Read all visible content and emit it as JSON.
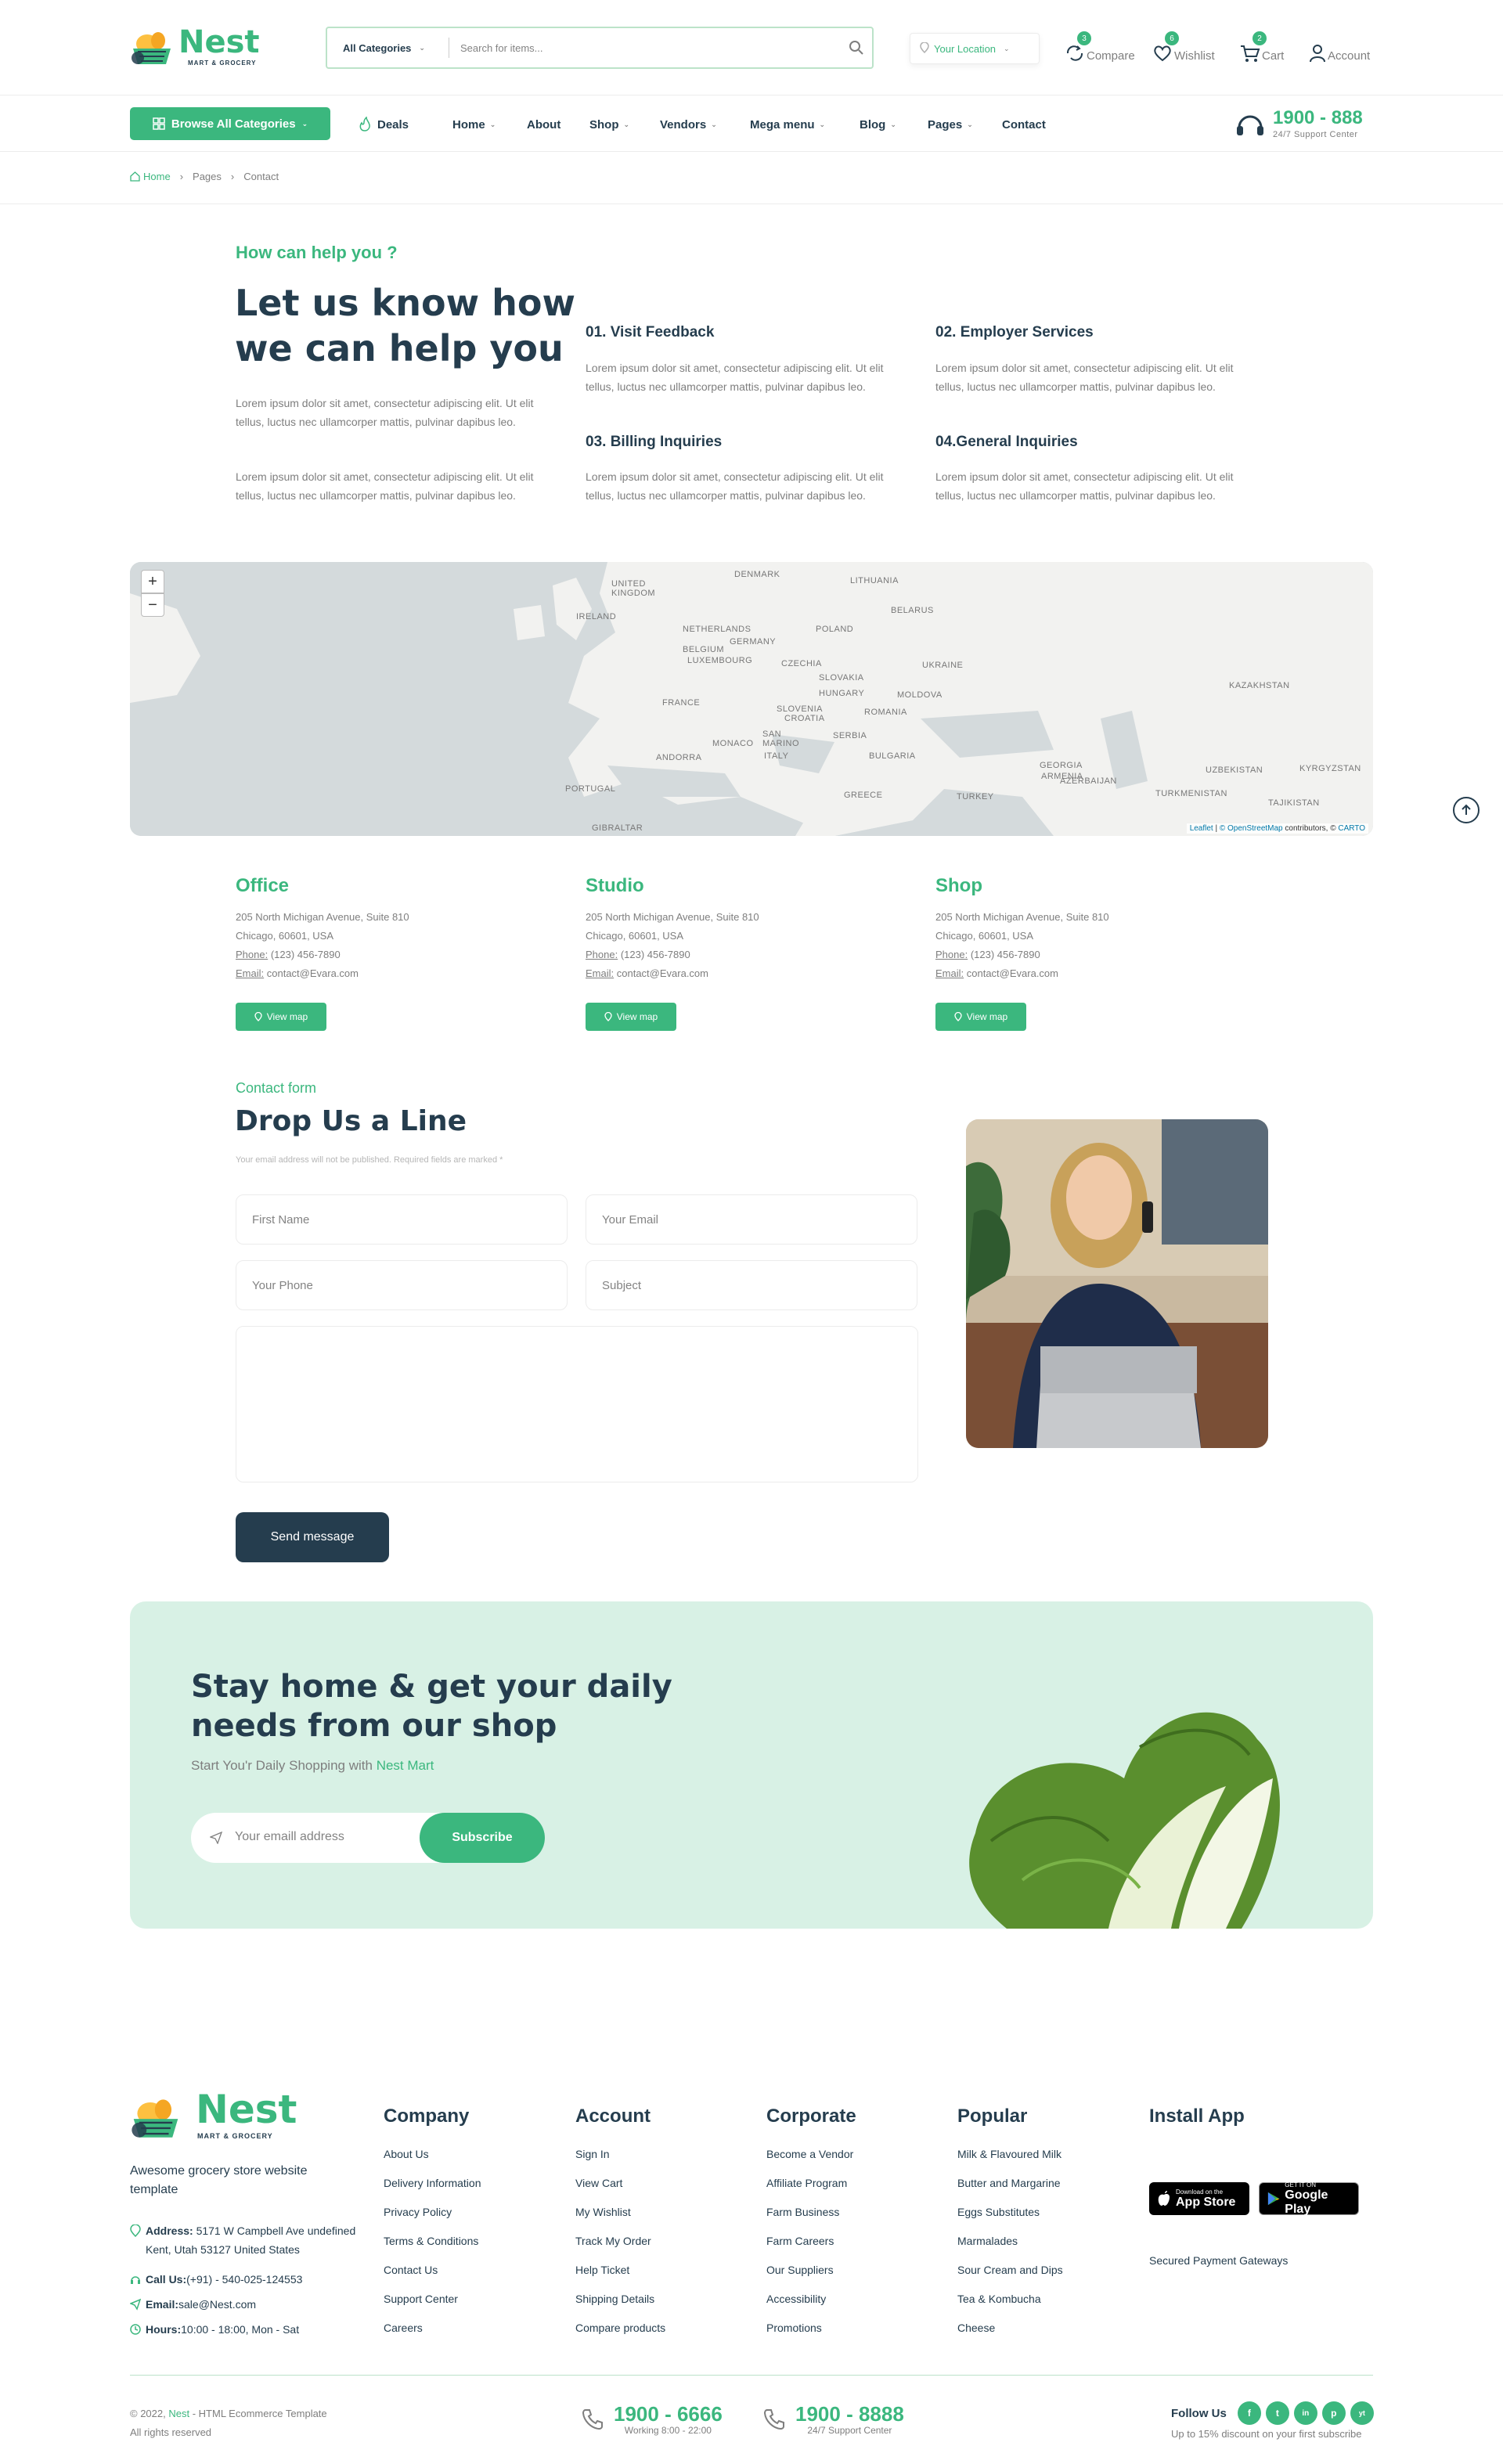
{
  "brand": {
    "name": "Nest",
    "tagline": "MART & GROCERY"
  },
  "header": {
    "category_select": "All Categories",
    "search_placeholder": "Search for items...",
    "location_placeholder": "Your Location",
    "actions": [
      {
        "label": "Compare",
        "badge": "3"
      },
      {
        "label": "Wishlist",
        "badge": "6"
      },
      {
        "label": "Cart",
        "badge": "2"
      },
      {
        "label": "Account",
        "badge": ""
      }
    ]
  },
  "nav": {
    "browse_label": "Browse All Categories",
    "deals": "Deals",
    "items": [
      "Home",
      "About",
      "Shop",
      "Vendors",
      "Mega menu",
      "Blog",
      "Pages",
      "Contact"
    ],
    "support_number": "1900 - 888",
    "support_label": "24/7 Support Center"
  },
  "breadcrumb": [
    "Home",
    "Pages",
    "Contact"
  ],
  "intro": {
    "kicker": "How can help you ?",
    "title_line1": "Let us know how",
    "title_line2": "we can help you",
    "lorem": "Lorem ipsum dolor sit amet, consectetur adipiscing elit. Ut elit tellus, luctus nec ullamcorper mattis, pulvinar dapibus leo.",
    "services": [
      {
        "title": "01. Visit Feedback",
        "accent": false
      },
      {
        "title": "02. Employer Services",
        "accent": false
      },
      {
        "title": "03. Billing Inquiries",
        "accent": true
      },
      {
        "title": "04.General Inquiries",
        "accent": false
      }
    ]
  },
  "map": {
    "zoom_in": "+",
    "zoom_out": "−",
    "labels": [
      "UNITED KINGDOM",
      "IRELAND",
      "DENMARK",
      "LITHUANIA",
      "NETHERLANDS",
      "BELARUS",
      "GERMANY",
      "POLAND",
      "BELGIUM",
      "LUXEMBOURG",
      "CZECHIA",
      "UKRAINE",
      "SLOVAKIA",
      "FRANCE",
      "HUNGARY",
      "MOLDOVA",
      "KAZAKHSTAN",
      "SLOVENIA",
      "CROATIA",
      "ROMANIA",
      "MONACO",
      "SAN MARINO",
      "SERBIA",
      "ANDORRA",
      "ITALY",
      "BULGARIA",
      "GEORGIA",
      "UZBEKISTAN",
      "KYRGYZSTAN",
      "ARMENIA",
      "AZERBAIJAN",
      "PORTUGAL",
      "GREECE",
      "TURKEY",
      "TURKMENISTAN",
      "TAJIKISTAN",
      "GIBRALTAR"
    ],
    "attribution_leaflet": "Leaflet",
    "attribution_osm": "© OpenStreetMap",
    "attribution_rest": "contributors, ©",
    "attribution_carto": "CARTO"
  },
  "offices": [
    {
      "name": "Office",
      "address1": "205 North Michigan Avenue, Suite 810",
      "address2": "Chicago, 60601, USA",
      "phone_label": "Phone:",
      "phone": "(123) 456-7890",
      "email_label": "Email:",
      "email": "contact@Evara.com",
      "button": "View map"
    },
    {
      "name": "Studio",
      "address1": "205 North Michigan Avenue, Suite 810",
      "address2": "Chicago, 60601, USA",
      "phone_label": "Phone:",
      "phone": "(123) 456-7890",
      "email_label": "Email:",
      "email": "contact@Evara.com",
      "button": "View map"
    },
    {
      "name": "Shop",
      "address1": "205 North Michigan Avenue, Suite 810",
      "address2": "Chicago, 60601, USA",
      "phone_label": "Phone:",
      "phone": "(123) 456-7890",
      "email_label": "Email:",
      "email": "contact@Evara.com",
      "button": "View map"
    }
  ],
  "contact_form": {
    "kicker": "Contact form",
    "title": "Drop Us a Line",
    "note": "Your email address will not be published. Required fields are marked *",
    "first_name": "First Name",
    "email": "Your Email",
    "phone": "Your Phone",
    "subject": "Subject",
    "message": "",
    "submit": "Send message"
  },
  "newsletter": {
    "title_line1": "Stay home & get your daily",
    "title_line2": "needs from our shop",
    "subtitle_prefix": "Start You'r Daily Shopping with",
    "subtitle_brand": "Nest Mart",
    "placeholder": "Your emaill address",
    "button": "Subscribe"
  },
  "footer": {
    "about": "Awesome grocery store website template",
    "address_label": "Address:",
    "address": "5171 W Campbell Ave undefined Kent, Utah 53127 United States",
    "call_label": "Call Us:",
    "call": "(+91) - 540-025-124553",
    "email_label": "Email:",
    "email": "sale@Nest.com",
    "hours_label": "Hours:",
    "hours": "10:00 - 18:00, Mon - Sat",
    "columns": [
      {
        "title": "Company",
        "links": [
          "About Us",
          "Delivery Information",
          "Privacy Policy",
          "Terms & Conditions",
          "Contact Us",
          "Support Center",
          "Careers"
        ]
      },
      {
        "title": "Account",
        "links": [
          "Sign In",
          "View Cart",
          "My Wishlist",
          "Track My Order",
          "Help Ticket",
          "Shipping Details",
          "Compare products"
        ]
      },
      {
        "title": "Corporate",
        "links": [
          "Become a Vendor",
          "Affiliate Program",
          "Farm Business",
          "Farm Careers",
          "Our Suppliers",
          "Accessibility",
          "Promotions"
        ]
      },
      {
        "title": "Popular",
        "links": [
          "Milk & Flavoured Milk",
          "Butter and Margarine",
          "Eggs Substitutes",
          "Marmalades",
          "Sour Cream and Dips",
          "Tea & Kombucha",
          "Cheese"
        ]
      }
    ],
    "install_title": "Install App",
    "appstore_small": "Download on the",
    "appstore_big": "App Store",
    "googleplay_small": "GET IT ON",
    "googleplay_big": "Google Play",
    "payment": "Secured Payment Gateways",
    "copyright_prefix": "© 2022,",
    "copyright_brand": "Nest",
    "copyright_rest": "- HTML Ecommerce Template",
    "rights": "All rights reserved",
    "phone1": "1900 - 6666",
    "phone1_sub": "Working 8:00 - 22:00",
    "phone2": "1900 - 8888",
    "phone2_sub": "24/7 Support Center",
    "follow": "Follow Us",
    "follow_sub": "Up to 15% discount on your first subscribe",
    "socials": [
      "f",
      "t",
      "in",
      "p",
      "yt"
    ]
  },
  "colors": {
    "primary": "#3bb77e",
    "heading": "#253d4e",
    "muted": "#7e7e7e",
    "newsletter_bg": "#d8f1e5"
  }
}
